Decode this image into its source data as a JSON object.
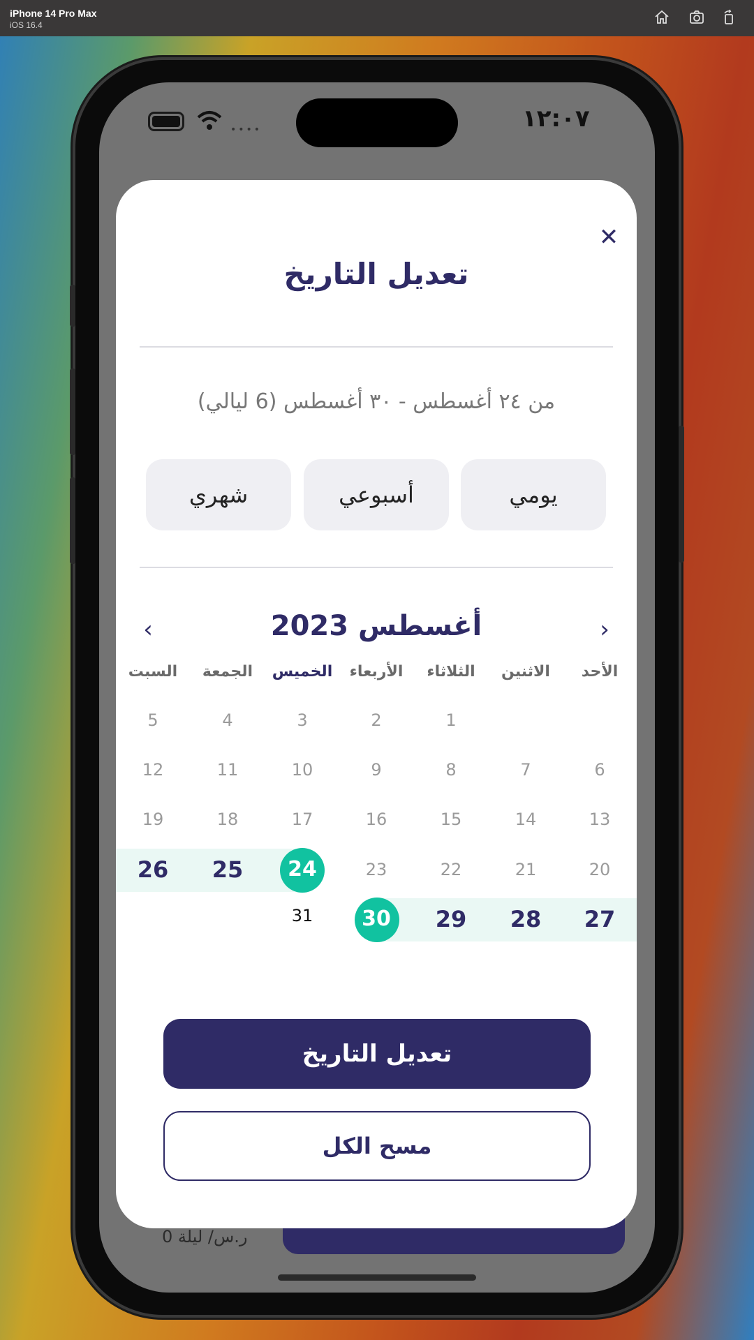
{
  "simulator": {
    "device": "iPhone 14 Pro Max",
    "os": "iOS 16.4"
  },
  "status_bar": {
    "time": "١٢:٠٧"
  },
  "background_screen": {
    "price_text": "0 ر.س/ ليلة"
  },
  "modal": {
    "title": "تعديل التاريخ",
    "range_summary": "من ٢٤ أغسطس - ٣٠ أغسطس (6 ليالي)",
    "segments": {
      "daily": "يومي",
      "weekly": "أسبوعي",
      "monthly": "شهري"
    },
    "calendar": {
      "month_title": "أغسطس 2023",
      "weekdays": [
        "الأحد",
        "الاثنين",
        "الثلاثاء",
        "الأربعاء",
        "الخميس",
        "الجمعة",
        "السبت"
      ],
      "today_weekday": "الخميس",
      "start_day": "24",
      "end_day": "30",
      "accent_color": "#11c2a0"
    },
    "primary_button": "تعديل التاريخ",
    "secondary_button": "مسح الكل"
  },
  "colors": {
    "brand": "#2f2b66",
    "accent": "#11c2a0",
    "range_band": "#eaf8f4"
  }
}
